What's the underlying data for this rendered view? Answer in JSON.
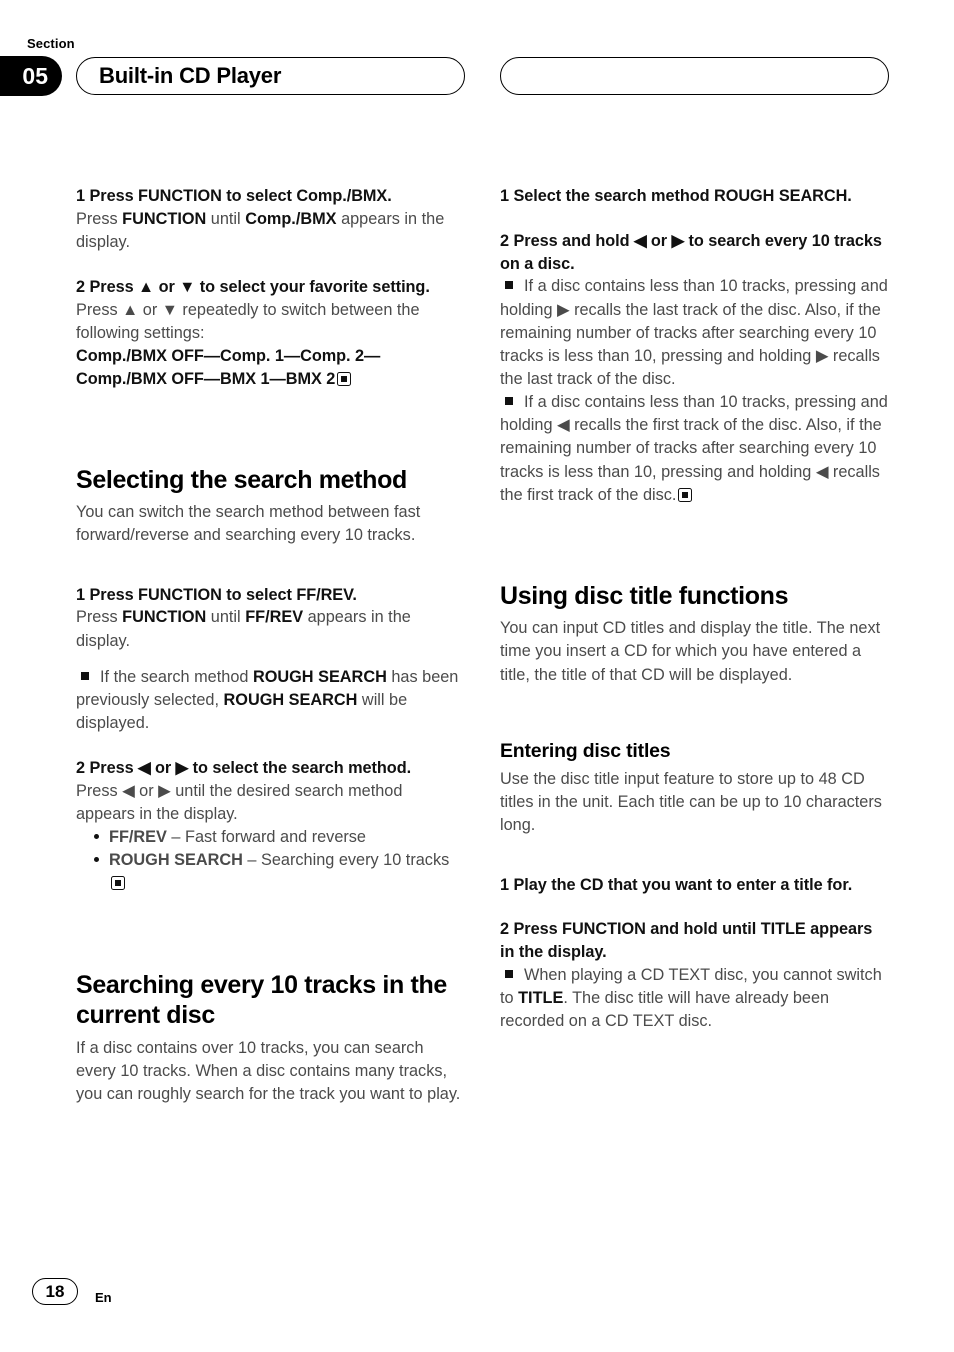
{
  "header": {
    "section_label": "Section",
    "section_number": "05",
    "left_pill_title": "Built-in CD Player",
    "right_pill_title": ""
  },
  "footer": {
    "page_number": "18",
    "language_code": "En"
  },
  "left_column": {
    "step1_heading": "1    Press FUNCTION to select Comp./BMX.",
    "step1_body_1": "Press ",
    "step1_body_b1": "FUNCTION",
    "step1_body_2": " until ",
    "step1_body_b2": "Comp./BMX",
    "step1_body_3": " appears in the display.",
    "step2_heading": "2    Press ▲ or ▼ to select your favorite setting.",
    "step2_body_1": "Press ▲ or ▼ repeatedly to switch between the following settings:",
    "step2_settings_line1": "Comp./BMX OFF—Comp. 1—Comp. 2—",
    "step2_settings_line2": "Comp./BMX OFF—BMX 1—BMX 2",
    "heading_selecting": "Selecting the search method",
    "selecting_body": "You can switch the search method between fast forward/reverse and searching every 10 tracks.",
    "sel_step1_heading": "1    Press FUNCTION to select FF/REV.",
    "sel_step1_body_1": "Press ",
    "sel_step1_body_b1": "FUNCTION",
    "sel_step1_body_2": " until ",
    "sel_step1_body_b2": "FF/REV",
    "sel_step1_body_3": " appears in the display.",
    "sel_note_1": "If the search method ",
    "sel_note_b1": "ROUGH SEARCH",
    "sel_note_2": " has been previously selected, ",
    "sel_note_b2": "ROUGH SEARCH",
    "sel_note_3": " will be displayed.",
    "sel_step2_heading": "2    Press ◀ or ▶ to select the search method.",
    "sel_step2_body": "Press ◀ or ▶ until the desired search method appears in the display.",
    "sublist": [
      {
        "term": "FF/REV",
        "desc": " – Fast forward and reverse",
        "eos": false
      },
      {
        "term": "ROUGH SEARCH",
        "desc": " – Searching every 10 tracks",
        "eos": true
      }
    ],
    "heading_searching": "Searching every 10 tracks in the current disc",
    "searching_body": "If a disc contains over 10 tracks, you can search every 10 tracks. When a disc contains many tracks, you can roughly search for the track you want to play."
  },
  "right_column": {
    "step1_heading": "1    Select the search method ROUGH SEARCH.",
    "step2_heading": "2    Press and hold ◀ or ▶ to search every 10 tracks on a disc.",
    "note1": "If a disc contains less than 10 tracks, pressing and holding ▶ recalls the last track of the disc. Also, if the remaining number of tracks after searching every 10 tracks is less than 10, pressing and holding ▶ recalls the last track of the disc.",
    "note2": "If a disc contains less than 10 tracks, pressing and holding ◀ recalls the first track of the disc. Also, if the remaining number of tracks after searching every 10 tracks is less than 10, pressing and holding ◀ recalls the first track of the disc.",
    "heading_using": "Using disc title functions",
    "using_body": "You can input CD titles and display the title. The next time you insert a CD for which you have entered a title, the title of that CD will be displayed.",
    "heading_entering": "Entering disc titles",
    "entering_body": "Use the disc title input feature to store up to 48 CD titles in the unit. Each title can be up to 10 characters long.",
    "ent_step1_heading": "1    Play the CD that you want to enter a title for.",
    "ent_step2_heading": "2    Press FUNCTION and hold until TITLE appears in the display.",
    "ent_note_1": "When playing a CD TEXT disc, you cannot switch to ",
    "ent_note_b1": "TITLE",
    "ent_note_2": ". The disc title will have already been recorded on a CD TEXT disc."
  }
}
